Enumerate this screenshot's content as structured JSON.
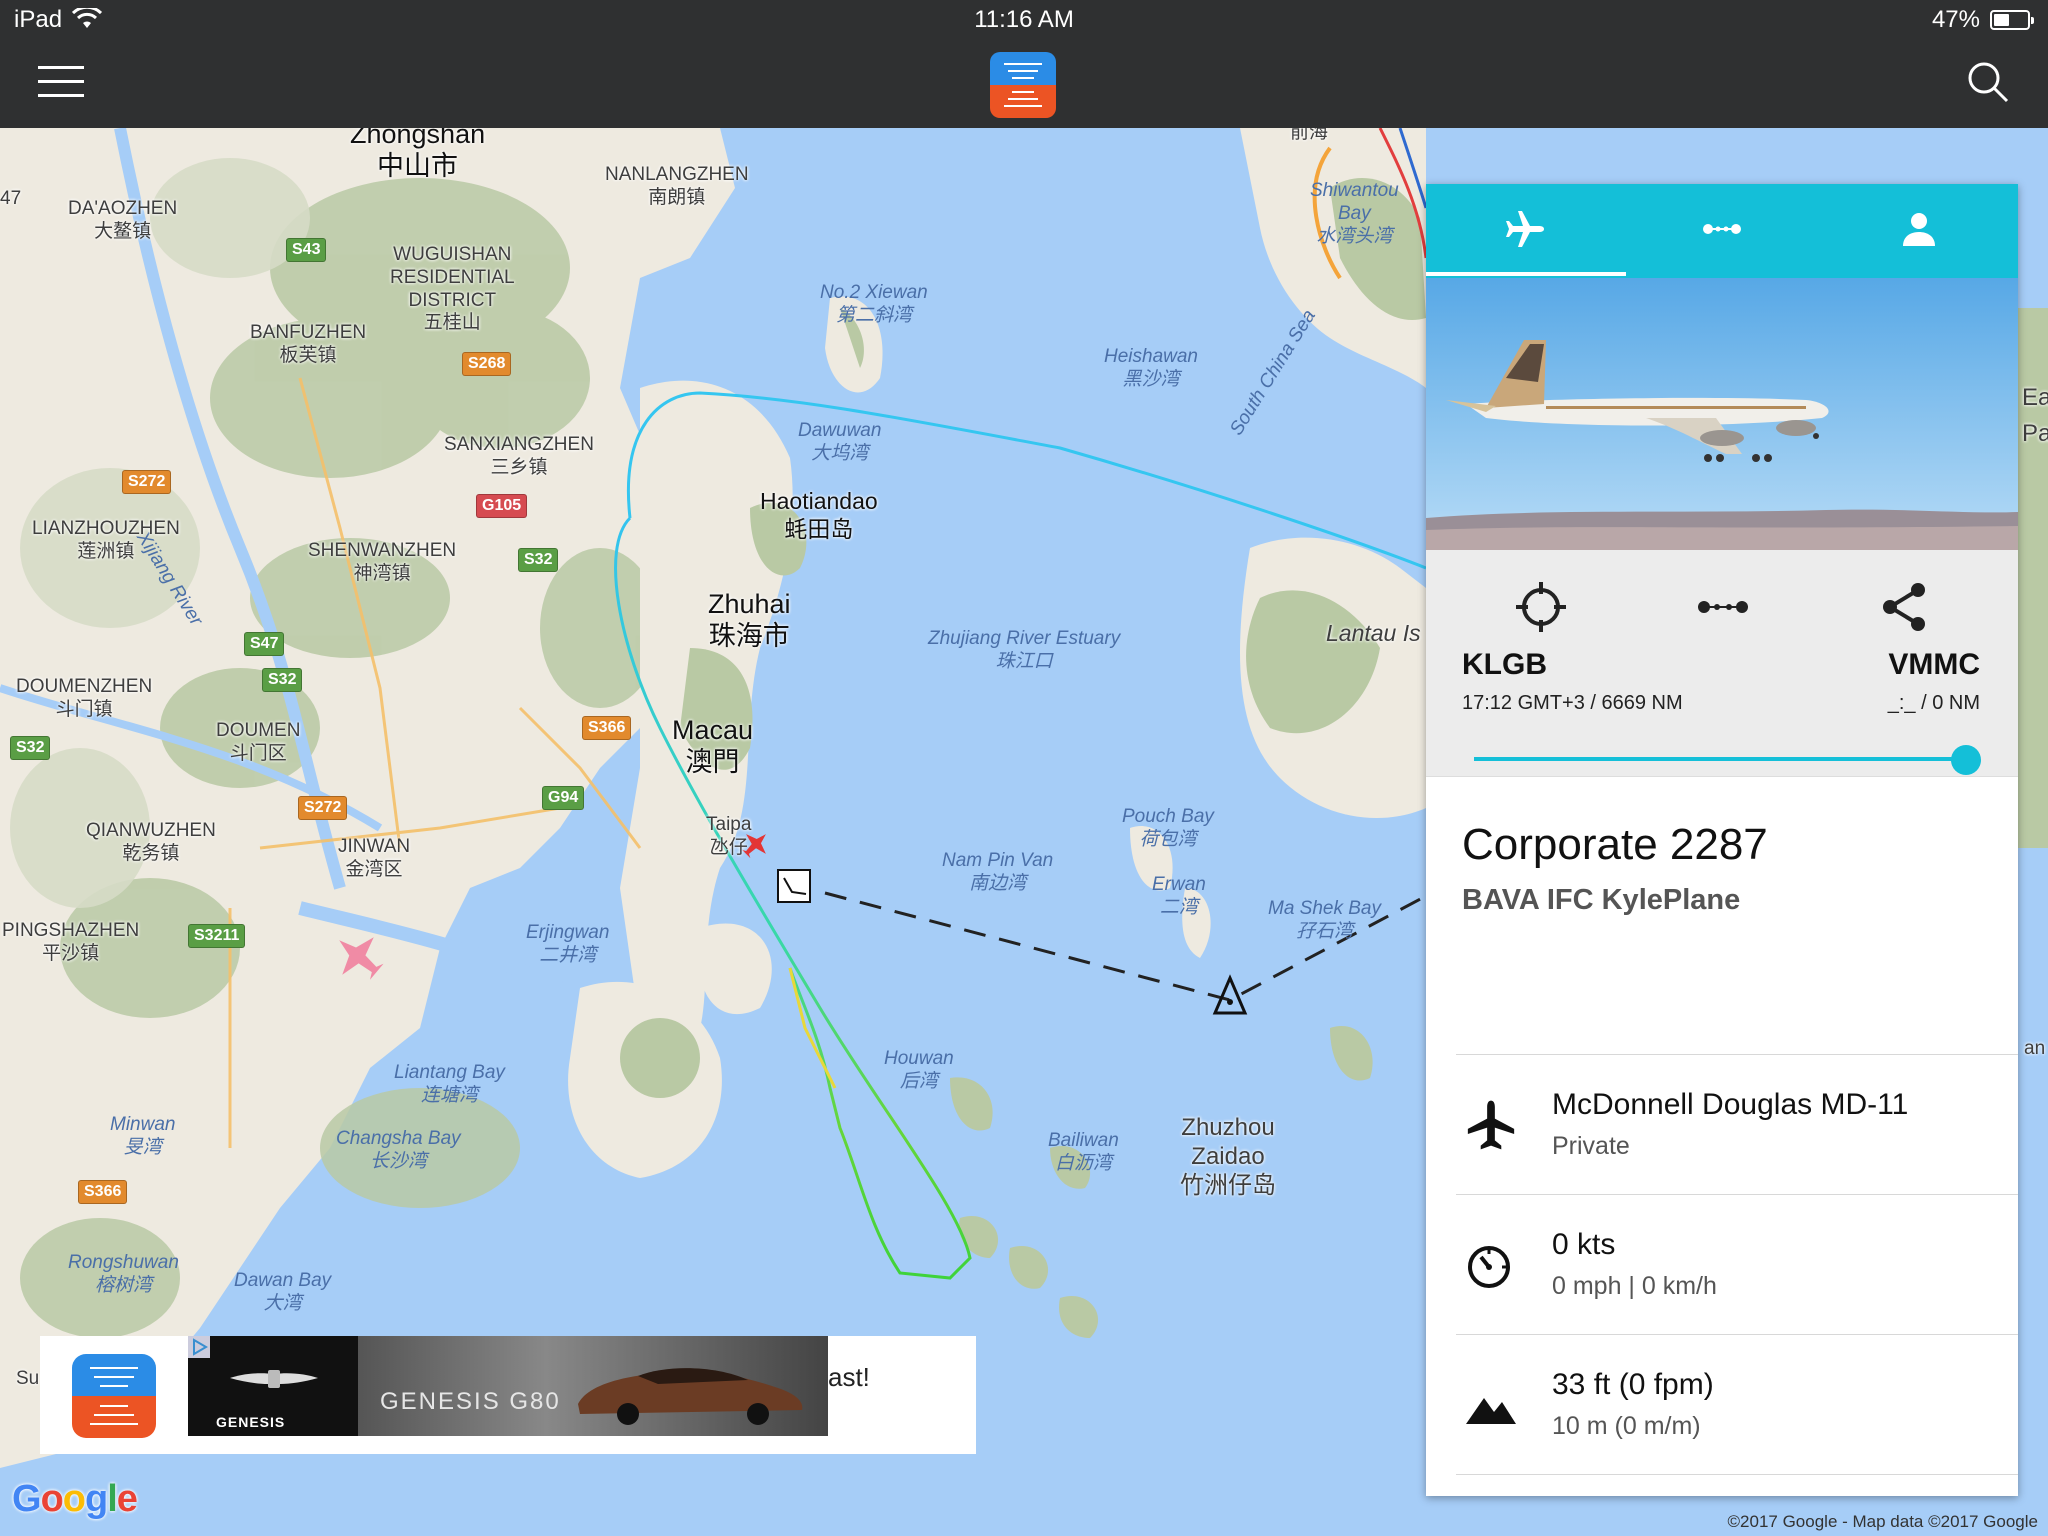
{
  "status_bar": {
    "device": "iPad",
    "time": "11:16 AM",
    "battery": "47%",
    "battery_level": 0.47
  },
  "app_bar": {
    "menu_icon": "hamburger-menu-icon",
    "logo_icon": "app-logo-icon",
    "search_icon": "search-icon"
  },
  "map": {
    "labels": {
      "zhongshan_en": "Zhongshan",
      "zhongshan_cn": "中山市",
      "nanlangzhen_en": "NANLANGZHEN",
      "nanlangzhen_cn": "南朗镇",
      "daaozhen_en": "DA'AOZHEN",
      "daaozhen_cn": "大鳌镇",
      "wuguishan_en": "WUGUISHAN\nRESIDENTIAL\nDISTRICT",
      "wuguishan_cn": "五桂山",
      "banfuzhen_en": "BANFUZHEN",
      "banfuzhen_cn": "板芙镇",
      "xijiang_river": "Xijiang River",
      "sanxiangzhen_en": "SANXIANGZHEN",
      "sanxiangzhen_cn": "三乡镇",
      "lianzhouzhen_en": "LIANZHOUZHEN",
      "lianzhouzhen_cn": "莲洲镇",
      "shenwanzhen_en": "SHENWANZHEN",
      "shenwanzhen_cn": "神湾镇",
      "doumenzhen_en": "DOUMENZHEN",
      "doumenzhen_cn": "斗门镇",
      "doumen_en": "DOUMEN",
      "doumen_cn": "斗门区",
      "qianwuzhen_en": "QIANWUZHEN",
      "qianwuzhen_cn": "乾务镇",
      "jinwan_en": "JINWAN",
      "jinwan_cn": "金湾区",
      "pingshazhen_en": "PINGSHAZHEN",
      "pingshazhen_cn": "平沙镇",
      "zhuhai_en": "Zhuhai",
      "zhuhai_cn": "珠海市",
      "macau_en": "Macau",
      "macau_cn": "澳門",
      "taipa_en": "Taipa",
      "taipa_cn": "氹仔",
      "haotiandao_en": "Haotiandao",
      "haotiandao_cn": "蚝田岛",
      "no2xiewan_en": "No.2 Xiewan",
      "no2xiewan_cn": "第二斜湾",
      "dawuwan_en": "Dawuwan",
      "dawuwan_cn": "大坞湾",
      "heishawan_en": "Heishawan",
      "heishawan_cn": "黑沙湾",
      "south_china_sea": "South China Sea",
      "shiwantou_en": "Shiwantou\nBay",
      "shiwantou_cn": "水湾头湾",
      "qianhai_cn": "前海",
      "zhujiang_en": "Zhujiang River Estuary",
      "zhujiang_cn": "珠江口",
      "lantau": "Lantau Is",
      "pouch_bay_en": "Pouch Bay",
      "pouch_bay_cn": "荷包湾",
      "nampinvan_en": "Nam Pin Van",
      "nampinvan_cn": "南边湾",
      "erwan_en": "Erwan",
      "erwan_cn": "二湾",
      "mashekbay_en": "Ma Shek Bay",
      "mashekbay_cn": "孖石湾",
      "erjingwan_en": "Erjingwan",
      "erjingwan_cn": "二井湾",
      "liantang_en": "Liantang Bay",
      "liantang_cn": "连塘湾",
      "minwan_en": "Minwan",
      "minwan_cn": "旻湾",
      "changsha_en": "Changsha Bay",
      "changsha_cn": "长沙湾",
      "houwan_en": "Houwan",
      "houwan_cn": "后湾",
      "bailiwan_en": "Bailiwan",
      "bailiwan_cn": "白沥湾",
      "zhuzhou_en": "Zhuzhou\nZaidao",
      "zhuzhou_cn": "竹洲仔岛",
      "rongshuwan_en": "Rongshuwan",
      "rongshuwan_cn": "榕树湾",
      "dawanbay_en": "Dawan Bay",
      "dawanbay_cn": "大湾",
      "edge_ea": "Ea",
      "edge_pa": "Pa",
      "edge_su": "Su",
      "edge_47": "47",
      "edge_an": "an"
    },
    "shields": {
      "s43": "S43",
      "s268": "S268",
      "s272a": "S272",
      "g105": "G105",
      "s32a": "S32",
      "s47": "S47",
      "s32b": "S32",
      "s32c": "S32",
      "s366a": "S366",
      "g94": "G94",
      "s272b": "S272",
      "s3211": "S3211",
      "s366b": "S366"
    }
  },
  "ad": {
    "text": "ast!",
    "brand": "GENESIS",
    "model": "GENESIS G80"
  },
  "google_logo": "Google",
  "copyright": "©2017 Google - Map data ©2017 Google",
  "panel": {
    "tabs": [
      {
        "icon": "airplane-icon",
        "active": true
      },
      {
        "icon": "route-dots-icon",
        "active": false
      },
      {
        "icon": "person-icon",
        "active": false
      }
    ],
    "origin": {
      "code": "KLGB",
      "detail": "17:12 GMT+3 / 6669 NM"
    },
    "destination": {
      "code": "VMMC",
      "detail": "_:_ / 0 NM"
    },
    "progress": 1.0,
    "callsign": "Corporate 2287",
    "operator": "BAVA IFC KylePlane",
    "aircraft": {
      "model": "McDonnell Douglas MD-11",
      "owner": "Private"
    },
    "speed": {
      "main": "0 kts",
      "sub": "0 mph | 0 km/h"
    },
    "altitude": {
      "main": "33 ft (0 fpm)",
      "sub": "10 m (0 m/m)"
    }
  },
  "colors": {
    "accent": "#14bfd8",
    "water": "#a6cdf7",
    "land": "#eeeae0",
    "topbar": "#2f3031"
  }
}
